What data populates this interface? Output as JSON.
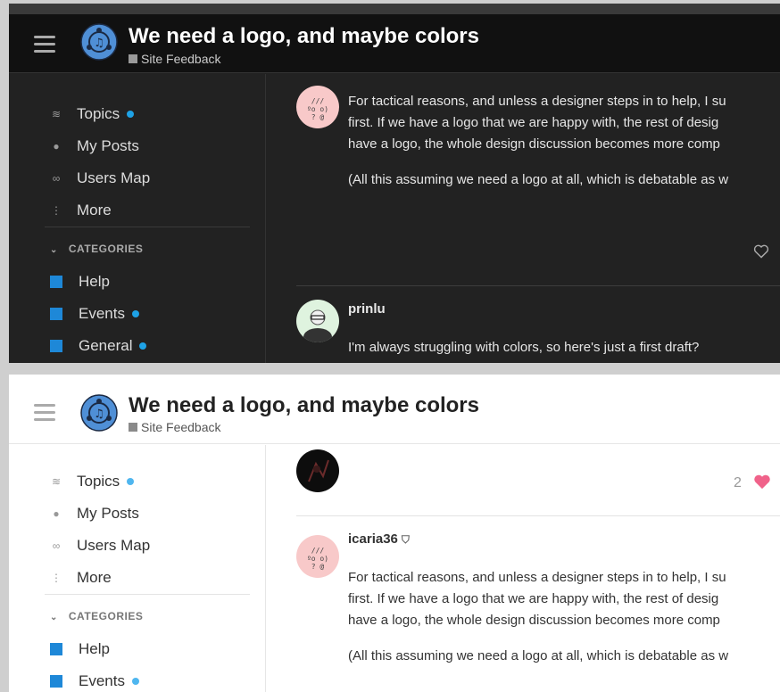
{
  "topic": {
    "title": "We need a logo, and maybe colors",
    "category": "Site Feedback"
  },
  "sidebar": {
    "items": [
      {
        "label": "Topics",
        "icon": "layers-icon"
      },
      {
        "label": "My Posts",
        "icon": "user-icon"
      },
      {
        "label": "Users Map",
        "icon": "link-icon"
      },
      {
        "label": "More",
        "icon": "vertical-ellipsis-icon"
      }
    ],
    "categories_heading": "CATEGORIES",
    "categories": [
      {
        "label": "Help"
      },
      {
        "label": "Events"
      },
      {
        "label": "General"
      }
    ]
  },
  "posts": {
    "icaria_lines": [
      "For tactical reasons, and unless a designer steps in to help, I su",
      "first. If we have a logo that we are happy with, the rest of desig",
      "have a logo, the whole design discussion becomes more comp",
      "(All this assuming we need a logo at all, which is debatable as w"
    ],
    "icaria_username": "icaria36",
    "prinlu_username": "prinlu",
    "prinlu_text": "I'm always struggling with colors, so here's just a first draft?",
    "like_count": "2"
  },
  "colors": {
    "accent": "#1e88d8",
    "dot_dark": "#1ea2e6",
    "heart": "#f0628a"
  }
}
